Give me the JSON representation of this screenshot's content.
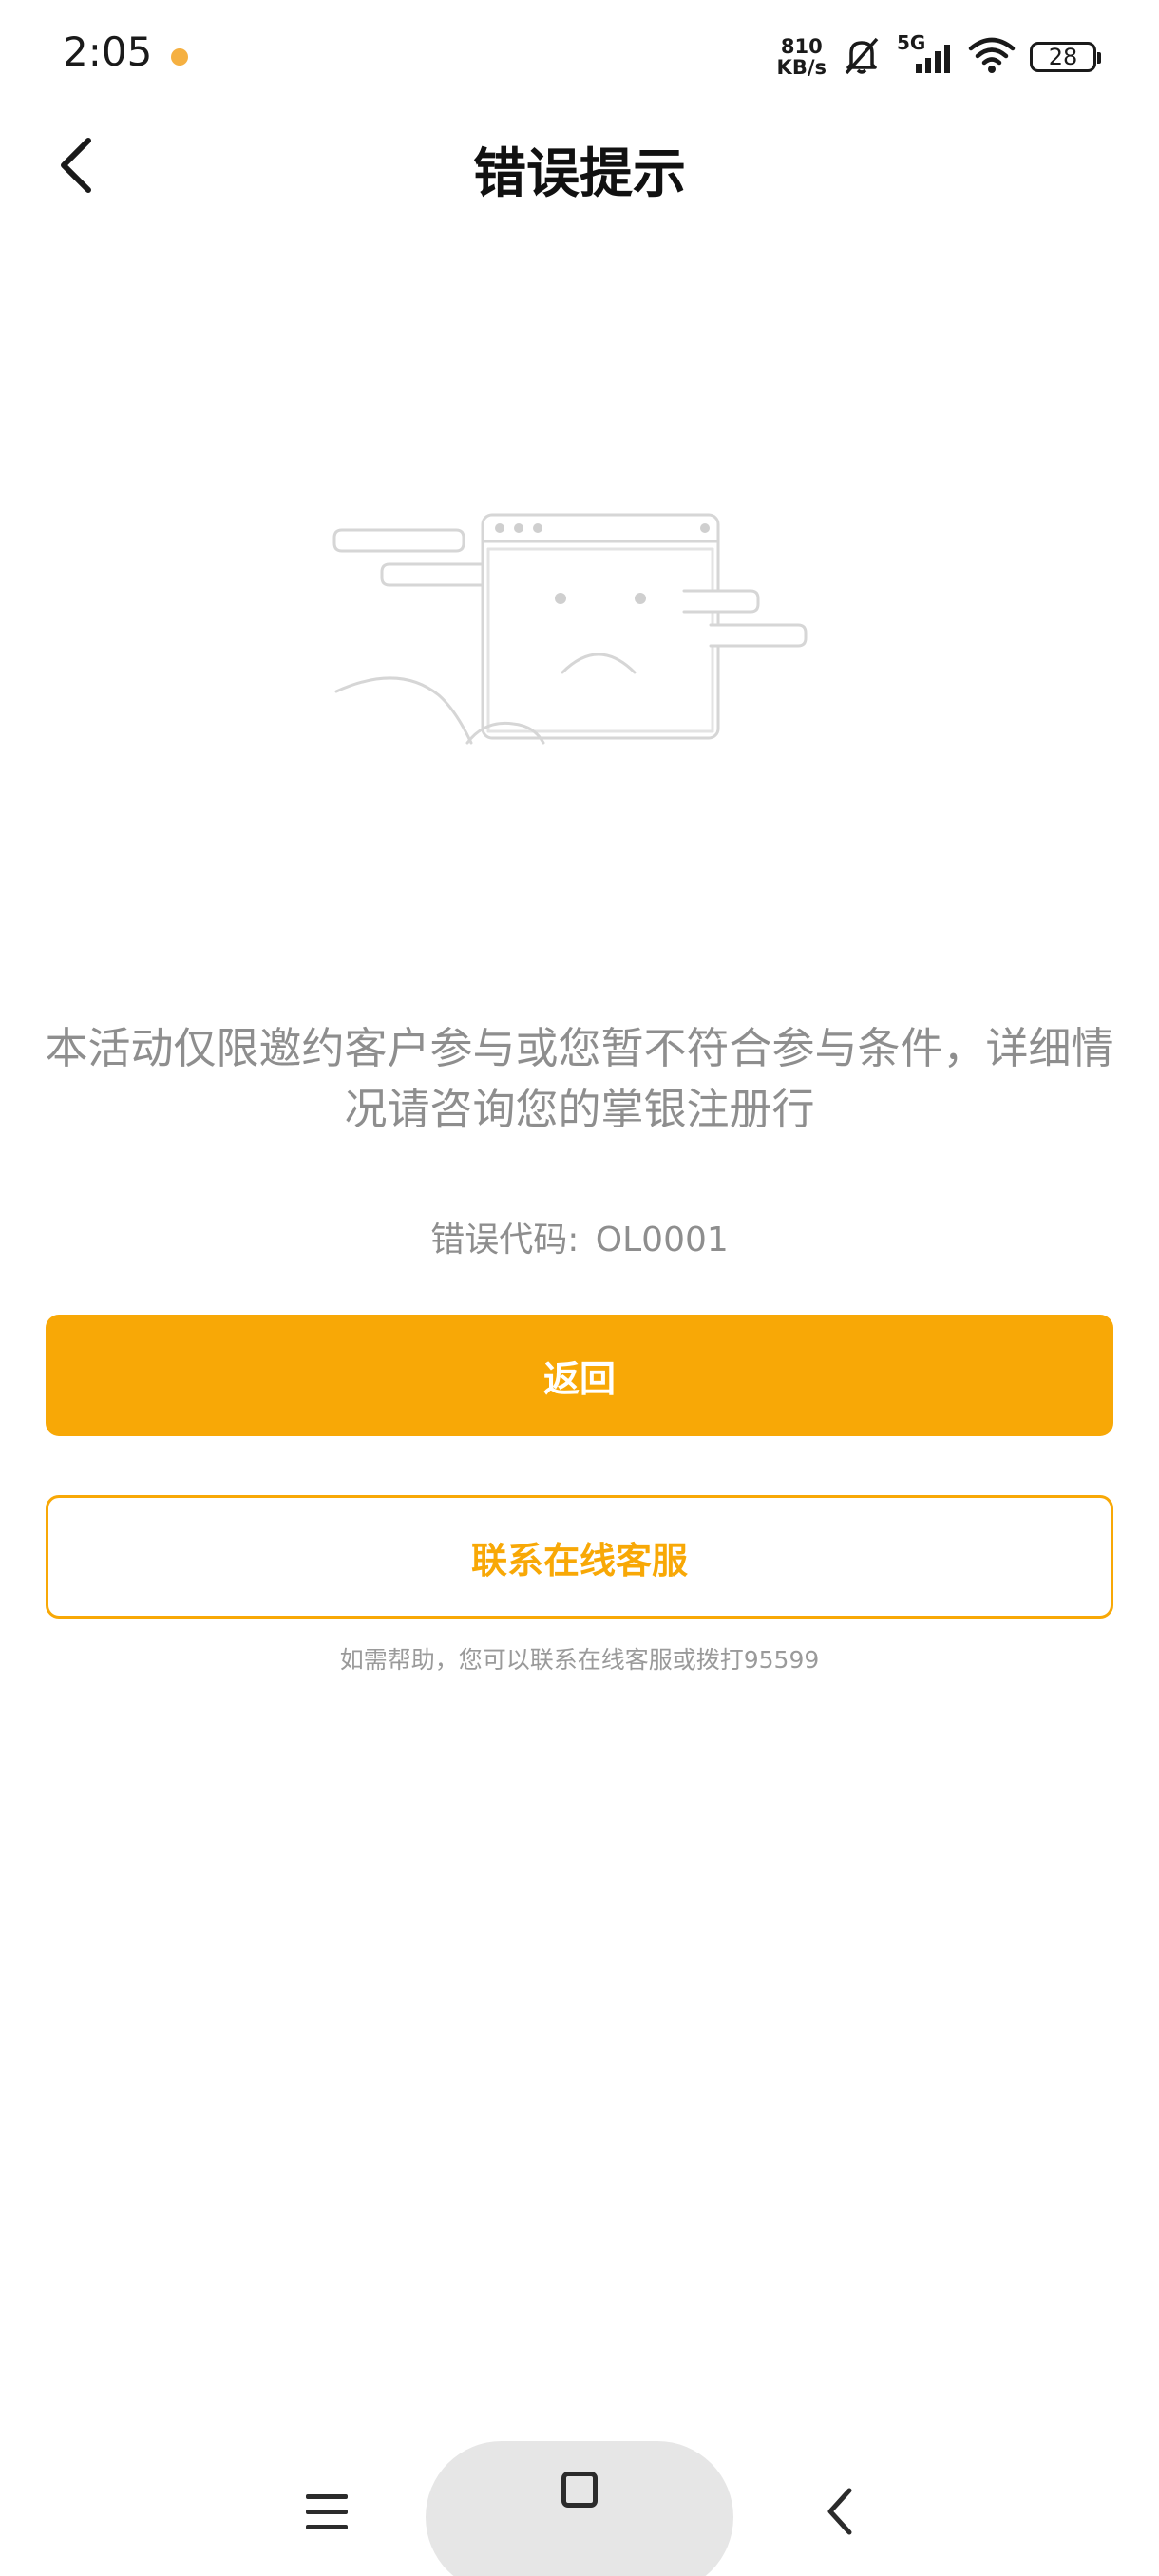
{
  "status_bar": {
    "time": "2:05",
    "net_speed_value": "810",
    "net_speed_unit": "KB/s",
    "network_type": "5G",
    "battery_level": "28",
    "notification_dot_color": "#f5b041",
    "icons": [
      "notification-dot-icon",
      "bell-muted-icon",
      "cellular-signal-icon",
      "wifi-icon",
      "battery-icon"
    ]
  },
  "header": {
    "title": "错误提示",
    "back_icon": "chevron-left-icon"
  },
  "illustration": {
    "icon": "sad-browser-window-illustration"
  },
  "message": {
    "text": "本活动仅限邀约客户参与或您暂不符合参与条件，详细情况请咨询您的掌银注册行",
    "error_code_label": "错误代码:",
    "error_code_value": "OL0001"
  },
  "actions": {
    "primary_label": "返回",
    "secondary_label": "联系在线客服",
    "help_text": "如需帮助，您可以联系在线客服或拨打95599"
  },
  "bottom_nav": {
    "icons": [
      "menu-icon",
      "home-icon",
      "back-icon"
    ]
  },
  "colors": {
    "accent": "#f8a806",
    "text_muted": "#8e8e8e"
  }
}
